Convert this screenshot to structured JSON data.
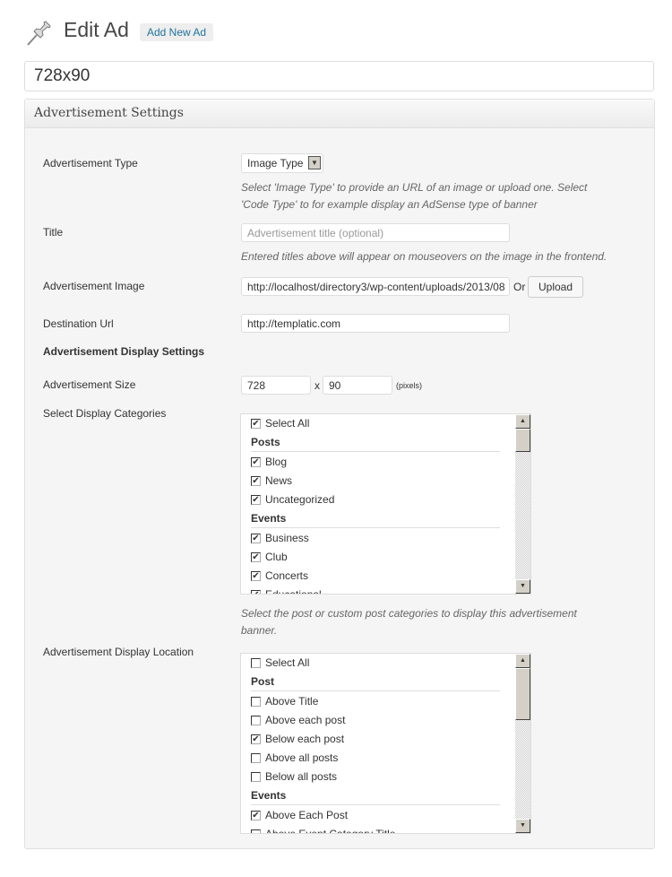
{
  "header": {
    "title": "Edit Ad",
    "add_new": "Add New Ad",
    "icon": "pushpin-icon"
  },
  "post_title": "728x90",
  "panel": {
    "title": "Advertisement Settings"
  },
  "fields": {
    "type": {
      "label": "Advertisement Type",
      "value": "Image Type",
      "help": "Select 'Image Type' to provide an URL of an image or upload one. Select 'Code Type' to for example display an AdSense type of banner"
    },
    "title": {
      "label": "Title",
      "placeholder": "Advertisement title (optional)",
      "help": "Entered titles above will appear on mouseovers on the image in the frontend."
    },
    "image": {
      "label": "Advertisement Image",
      "value": "http://localhost/directory3/wp-content/uploads/2013/08",
      "or": "Or",
      "upload": "Upload"
    },
    "url": {
      "label": "Destination Url",
      "value": "http://templatic.com"
    },
    "display_heading": "Advertisement Display Settings",
    "size": {
      "label": "Advertisement Size",
      "width": "728",
      "x": "x",
      "height": "90",
      "unit": "(pixels)"
    },
    "categories": {
      "label": "Select Display Categories",
      "help": "Select the post or custom post categories to display this advertisement banner.",
      "items": [
        {
          "type": "option",
          "label": "Select All",
          "checked": true
        },
        {
          "type": "group",
          "label": "Posts"
        },
        {
          "type": "option",
          "label": "Blog",
          "checked": true
        },
        {
          "type": "option",
          "label": "News",
          "checked": true
        },
        {
          "type": "option",
          "label": "Uncategorized",
          "checked": true
        },
        {
          "type": "group",
          "label": "Events"
        },
        {
          "type": "option",
          "label": "Business",
          "checked": true
        },
        {
          "type": "option",
          "label": "Club",
          "checked": true
        },
        {
          "type": "option",
          "label": "Concerts",
          "checked": true
        },
        {
          "type": "option",
          "label": "Educational",
          "checked": true
        }
      ]
    },
    "location": {
      "label": "Advertisement Display Location",
      "items": [
        {
          "type": "option",
          "label": "Select All",
          "checked": false
        },
        {
          "type": "group",
          "label": "Post"
        },
        {
          "type": "option",
          "label": "Above Title",
          "checked": false
        },
        {
          "type": "option",
          "label": "Above each post",
          "checked": false
        },
        {
          "type": "option",
          "label": "Below each post",
          "checked": true
        },
        {
          "type": "option",
          "label": "Above all posts",
          "checked": false
        },
        {
          "type": "option",
          "label": "Below all posts",
          "checked": false
        },
        {
          "type": "group",
          "label": "Events"
        },
        {
          "type": "option",
          "label": "Above Each Post",
          "checked": true
        },
        {
          "type": "option",
          "label": "Above Event Category Title",
          "checked": false
        }
      ]
    }
  }
}
